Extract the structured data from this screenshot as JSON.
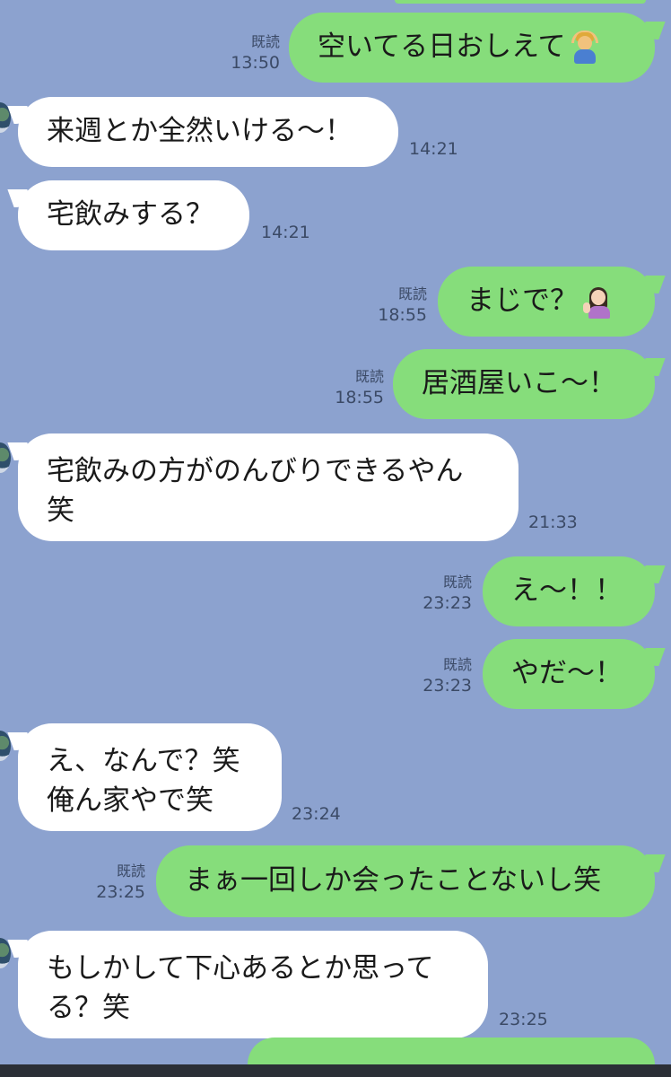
{
  "messages": [
    {
      "side": "out",
      "text": "空いてる日おしえて",
      "emoji": "person-gesturing-ok-icon",
      "read": "既読",
      "time": "13:50"
    },
    {
      "side": "in",
      "text": "来週とか全然いける〜！",
      "time": "14:21"
    },
    {
      "side": "in",
      "text": "宅飲みする？",
      "time": "14:21"
    },
    {
      "side": "out",
      "text": "まじで？",
      "emoji": "woman-tipping-hand-icon",
      "read": "既読",
      "time": "18:55"
    },
    {
      "side": "out",
      "text": "居酒屋いこ〜！",
      "read": "既読",
      "time": "18:55"
    },
    {
      "side": "in",
      "lines": [
        "宅飲みの方がのんびりできるやん",
        "笑"
      ],
      "time": "21:33"
    },
    {
      "side": "out",
      "text": "え〜！！",
      "read": "既読",
      "time": "23:23"
    },
    {
      "side": "out",
      "text": "やだ〜！",
      "read": "既読",
      "time": "23:23"
    },
    {
      "side": "in",
      "lines": [
        "え、なんで？笑",
        "俺ん家やで笑"
      ],
      "time": "23:24"
    },
    {
      "side": "out",
      "text": "まぁ一回しか会ったことないし笑",
      "read": "既読",
      "time": "23:25"
    },
    {
      "side": "in",
      "lines": [
        "もしかして下心あるとか思って",
        "る？笑"
      ],
      "time": "23:25"
    }
  ]
}
